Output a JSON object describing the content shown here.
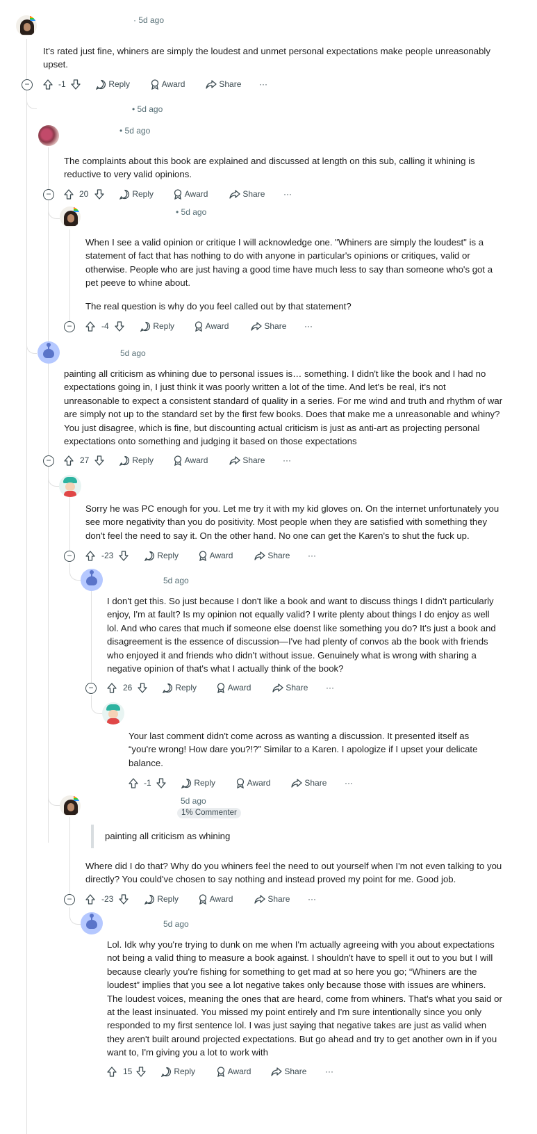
{
  "ui": {
    "reply": "Reply",
    "award": "Award",
    "share": "Share",
    "more": "···",
    "collapse": "−"
  },
  "comments": [
    {
      "id": "c1",
      "time": "· 5d ago",
      "votes": "-1",
      "body": [
        "It's rated just fine, whiners are simply the loudest and unmet personal expectations make people unreasonably upset."
      ]
    },
    {
      "id": "c2",
      "time": "• 5d ago"
    },
    {
      "id": "c3",
      "time": "• 5d ago",
      "votes": "20",
      "body": [
        "The complaints about this book are explained and discussed at length on this sub, calling it whining is reductive to very valid opinions."
      ]
    },
    {
      "id": "c4",
      "time": "• 5d ago",
      "votes": "-4",
      "body": [
        "When I see a valid opinion or critique I will acknowledge one. \"Whiners are simply the loudest\" is a statement of fact that has nothing to do with anyone in particular's opinions or critiques, valid or otherwise. People who are just having a good time have much less to say than someone who's got a pet peeve to whine about.",
        "The real question is why do you feel called out by that statement?"
      ]
    },
    {
      "id": "c5",
      "time": "5d ago",
      "votes": "27",
      "body": [
        "painting all criticism as whining due to personal issues is… something. I didn't like the book and I had no expectations going in, I just think it was poorly written a lot of the time. And let's be real, it's not unreasonable to expect a consistent standard of quality in a series. For me wind and truth and rhythm of war are simply not up to the standard set by the first few books. Does that make me a unreasonable and whiny? You just disagree, which is fine, but discounting actual criticism is just as anti-art as projecting personal expectations onto something and judging it based on those expectations"
      ]
    },
    {
      "id": "c6",
      "votes": "-23",
      "body": [
        "Sorry he was PC enough for you. Let me try it with my kid gloves on. On the internet unfortunately you see more negativity than you do positivity. Most people when they are satisfied with something they don't feel the need to say it. On the other hand. No one can get the Karen's to shut the fuck up."
      ]
    },
    {
      "id": "c7",
      "time": "5d ago",
      "votes": "26",
      "body": [
        "I don't get this. So just because I don't like a book and want to discuss things I didn't particularly enjoy, I'm at fault? Is my opinion not equally valid? I write plenty about things I do enjoy as well lol. And who cares that much if someone else doenst like something you do? It's just a book and disagreement is the essence of discussion—I've had plenty of convos ab the book with friends who enjoyed it and friends who didn't without issue. Genuinely what is wrong with sharing a negative opinion of that's what I actually think of the book?"
      ]
    },
    {
      "id": "c8",
      "votes": "-1",
      "body": [
        "Your last comment didn't come across as wanting a discussion. It presented itself as “you're wrong! How dare you?!?” Similar to a Karen. I apologize if I upset your delicate balance."
      ]
    },
    {
      "id": "c9",
      "time": "5d ago",
      "flair": "1% Commenter",
      "votes": "-23",
      "quote": "painting all criticism as whining",
      "body": [
        "Where did I do that? Why do you whiners feel the need to out yourself when I'm not even talking to you directly? You could've chosen to say nothing and instead proved my point for me. Good job."
      ]
    },
    {
      "id": "c10",
      "time": "5d ago",
      "votes": "15",
      "body": [
        "Lol. Idk why you're trying to dunk on me when I'm actually agreeing with you about expectations not being a valid thing to measure a book against. I shouldn't have to spell it out to you but I will because clearly you're fishing for something to get mad at so here you go; “Whiners are the loudest” implies that you see a lot negative takes only because those with issues are whiners. The loudest voices, meaning the ones that are heard, come from whiners. That's what you said or at the least insinuated. You missed my point entirely and I'm sure intentionally since you only responded to my first sentence lol. I was just saying that negative takes are just as valid when they aren't built around projected expectations. But go ahead and try to get another own in if you want to, I'm giving you a lot to work with"
      ]
    }
  ]
}
